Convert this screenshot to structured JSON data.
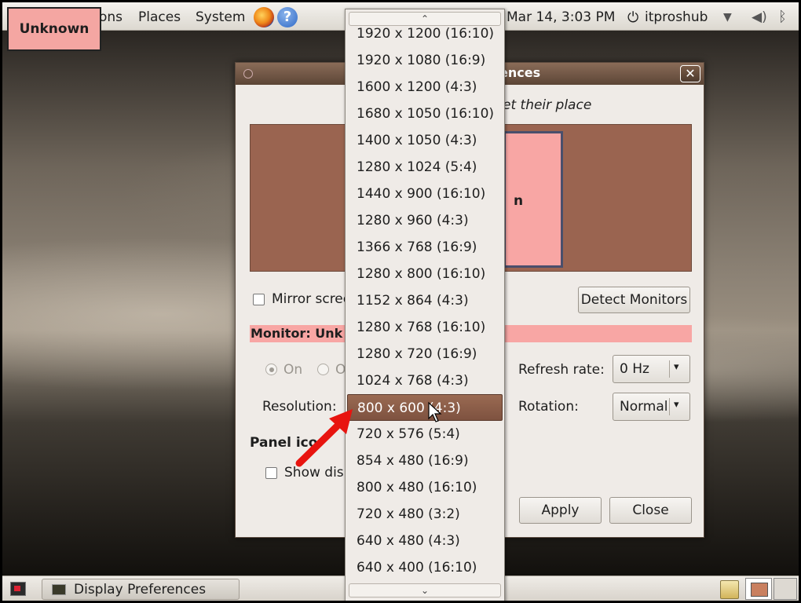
{
  "top_panel": {
    "menus": [
      "Applications",
      "Places",
      "System"
    ],
    "applications_visible": "ons",
    "clock": "Mar 14,  3:03 PM",
    "user": "itproshub",
    "icons": [
      "firefox-icon",
      "help-icon",
      "power-icon",
      "network-icon",
      "volume-icon",
      "bluetooth-icon"
    ]
  },
  "overlay_label": "Unknown",
  "dialog": {
    "title": "Display Preferences",
    "title_visible": "ences",
    "close_glyph": "✕",
    "hint_visible": "et their place",
    "monitor_box_visible": "n",
    "mirror_label_visible": "Mirror scree",
    "detect_button": "Detect Monitors",
    "monitor_header_visible": "Monitor: Unk",
    "radio_on_label": "On",
    "radio_off_label_visible": "O",
    "refresh_label": "Refresh rate:",
    "refresh_value": "0 Hz",
    "resolution_label": "Resolution:",
    "rotation_label": "Rotation:",
    "rotation_value": "Normal",
    "panel_icon_heading_visible": "Panel ico",
    "show_label_visible": "Show disp",
    "apply_button": "Apply",
    "close_button": "Close"
  },
  "dropdown": {
    "scroll_up": "⌃",
    "scroll_down": "⌄",
    "selected": "800 x 600 (4:3)",
    "items": [
      "1920 x 1200 (16:10)",
      "1920 x 1080 (16:9)",
      "1600 x 1200 (4:3)",
      "1680 x 1050 (16:10)",
      "1400 x 1050 (4:3)",
      "1280 x 1024 (5:4)",
      "1440 x 900 (16:10)",
      "1280 x 960 (4:3)",
      "1366 x 768 (16:9)",
      "1280 x 800 (16:10)",
      "1152 x 864 (4:3)",
      "1280 x 768 (16:10)",
      "1280 x 720 (16:9)",
      "1024 x 768 (4:3)",
      "800 x 600 (4:3)",
      "720 x 576 (5:4)",
      "854 x 480 (16:9)",
      "800 x 480 (16:10)",
      "720 x 480 (3:2)",
      "640 x 480 (4:3)",
      "640 x 400 (16:10)"
    ]
  },
  "bottom_panel": {
    "task": "Display Preferences"
  },
  "colors": {
    "accent": "#8a6c58",
    "highlight": "#f8a6a4",
    "selection": "#9a6a52",
    "arrow": "#e8140f"
  }
}
